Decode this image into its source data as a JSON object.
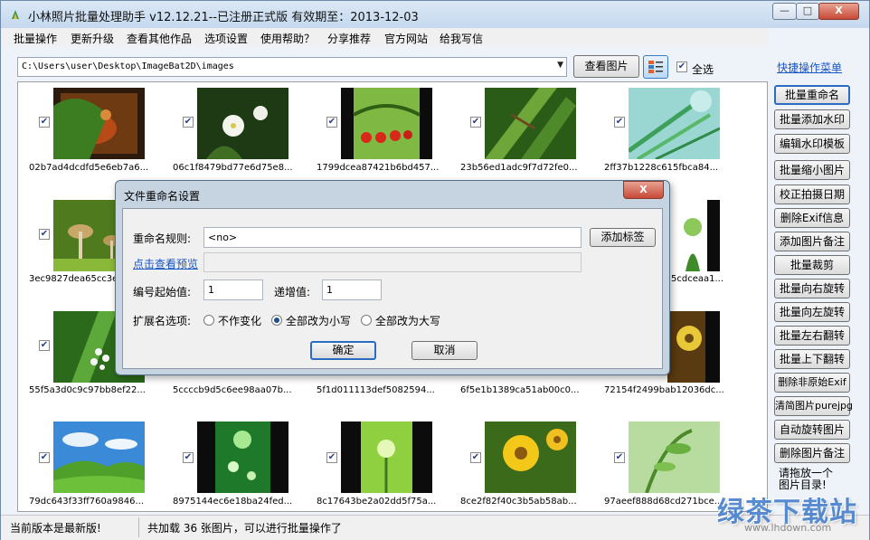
{
  "window": {
    "title": "小林照片批量处理助手 v12.12.21--已注册正式版 有效期至：2013-12-03",
    "minimize_glyph": "—",
    "maximize_glyph": "□",
    "close_glyph": "X"
  },
  "menu": [
    "批量操作",
    "更新升级",
    "查看其他作品",
    "选项设置",
    "使用帮助？",
    "分享推荐",
    "官方网站",
    "给我写信"
  ],
  "toolbar": {
    "path": "C:\\Users\\user\\Desktop\\ImageBat2D\\images",
    "view_button": "查看图片",
    "select_all_label": "全选",
    "select_all_checked": true
  },
  "sidebar": {
    "title": "快捷操作菜单",
    "buttons": [
      "批量重命名",
      "批量添加水印",
      "编辑水印模板",
      "批量缩小图片",
      "校正拍摄日期",
      "删除Exif信息",
      "添加图片备注",
      "批量裁剪",
      "批量向右旋转",
      "批量向左旋转",
      "批量左右翻转",
      "批量上下翻转",
      "删除非原始Exif",
      "清简图片purejpg",
      "自动旋转图片",
      "删除图片备注"
    ],
    "note": "请拖放一个图片目录!"
  },
  "thumbnails": [
    {
      "name": "02b7ad4dcdfd5e6eb7a6...",
      "checked": true
    },
    {
      "name": "06c1f8479bd77e6d75e8...",
      "checked": true
    },
    {
      "name": "1799dcea87421b6bd457...",
      "checked": true
    },
    {
      "name": "23b56ed1adc9f7d72fe0...",
      "checked": true
    },
    {
      "name": "2ff37b1228c615fbca84...",
      "checked": true
    },
    {
      "name": "3ec9827dea65cc3e",
      "checked": true
    },
    {
      "name": "5cdceaa1...",
      "checked": true
    },
    {
      "name": "55f5a3d0c9c97bb8ef22...",
      "checked": true
    },
    {
      "name": "5ccccb9d5c6ee98aa07b...",
      "checked": true
    },
    {
      "name": "5f1d011113def5082594...",
      "checked": true
    },
    {
      "name": "6f5e1b1389ca51ab00c0...",
      "checked": true
    },
    {
      "name": "72154f2499bab12036dc...",
      "checked": true
    },
    {
      "name": "79dc643f33ff760a9846...",
      "checked": true
    },
    {
      "name": "8975144ec6e18ba24fed...",
      "checked": true
    },
    {
      "name": "8c17643be2a02dd5f75a...",
      "checked": true
    },
    {
      "name": "8ce2f82f40c3b5ab58ab...",
      "checked": true
    },
    {
      "name": "97aeef888d68cd271bce...",
      "checked": true
    }
  ],
  "dialog": {
    "title": "文件重命名设置",
    "close_glyph": "X",
    "rule_label": "重命名规则:",
    "rule_value": "<no>",
    "add_tag_button": "添加标签",
    "preview_link": "点击查看预览",
    "preview_value": "",
    "start_label": "编号起始值:",
    "start_value": "1",
    "step_label": "递增值:",
    "step_value": "1",
    "ext_label": "扩展名选项:",
    "ext_options": [
      "不作变化",
      "全部改为小写",
      "全部改为大写"
    ],
    "ext_selected": 1,
    "ok_button": "确定",
    "cancel_button": "取消"
  },
  "status": {
    "left": "当前版本是最新版!",
    "right": "共加载 36 张图片，可以进行批量操作了"
  },
  "watermark": {
    "text": "绿茶下载站",
    "url": "www.lhdown.com"
  },
  "colors": {
    "accent_blue": "#2c6bc2",
    "link_blue": "#1a56c4",
    "close_red": "#c74a36"
  }
}
